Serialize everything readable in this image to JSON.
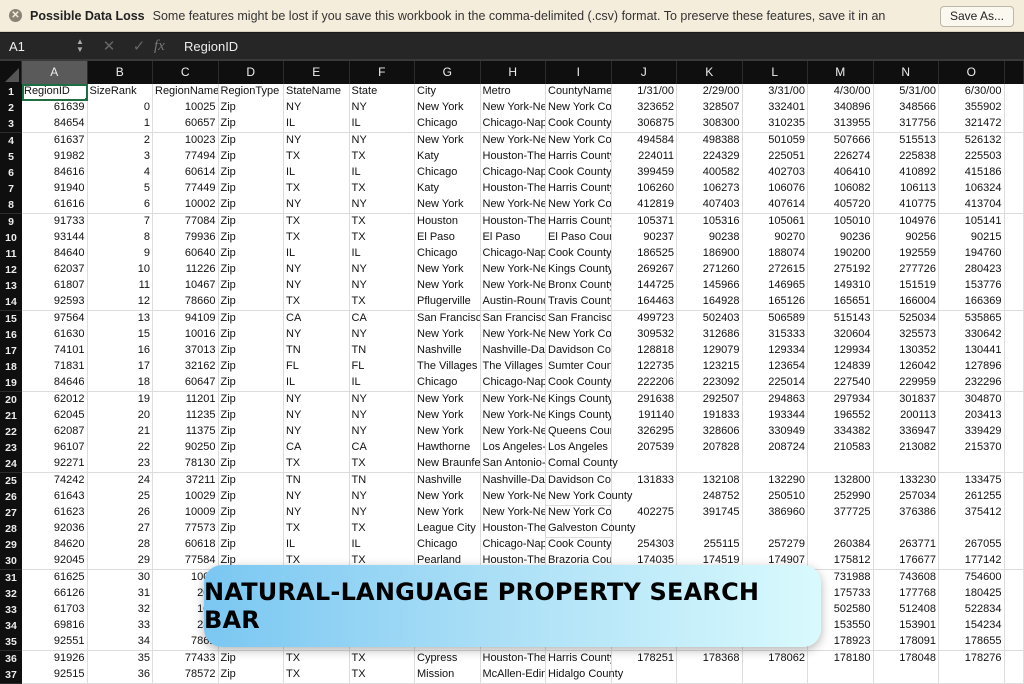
{
  "notice": {
    "icon": "close-circle-icon",
    "title": "Possible Data Loss",
    "message": "Some features might be lost if you save this workbook in the comma-delimited (.csv) format. To preserve these features, save it in an",
    "save_as": "Save As..."
  },
  "formula_bar": {
    "cell_ref": "A1",
    "cancel": "✕",
    "confirm": "✓",
    "fx": "fx",
    "value": "RegionID"
  },
  "columns": [
    "A",
    "B",
    "C",
    "D",
    "E",
    "F",
    "G",
    "H",
    "I",
    "J",
    "K",
    "L",
    "M",
    "N",
    "O"
  ],
  "selected_cell": "A1",
  "rows": [
    {
      "n": "1",
      "cells": [
        "RegionID",
        "SizeRank",
        "RegionName",
        "RegionType",
        "StateName",
        "State",
        "City",
        "Metro",
        "CountyName",
        "1/31/00",
        "2/29/00",
        "3/31/00",
        "4/30/00",
        "5/31/00",
        "6/30/00"
      ]
    },
    {
      "n": "2",
      "cells": [
        "61639",
        "0",
        "10025",
        "Zip",
        "NY",
        "NY",
        "New York",
        "New York-Ne",
        "New York Co",
        "323652",
        "328507",
        "332401",
        "340896",
        "348566",
        "355902"
      ]
    },
    {
      "n": "3",
      "cells": [
        "84654",
        "1",
        "60657",
        "Zip",
        "IL",
        "IL",
        "Chicago",
        "Chicago-Nap",
        "Cook County",
        "306875",
        "308300",
        "310235",
        "313955",
        "317756",
        "321472"
      ]
    },
    {
      "n": "4",
      "cells": [
        "61637",
        "2",
        "10023",
        "Zip",
        "NY",
        "NY",
        "New York",
        "New York-Ne",
        "New York Co",
        "494584",
        "498388",
        "501059",
        "507666",
        "515513",
        "526132"
      ]
    },
    {
      "n": "5",
      "cells": [
        "91982",
        "3",
        "77494",
        "Zip",
        "TX",
        "TX",
        "Katy",
        "Houston-The",
        "Harris County",
        "224011",
        "224329",
        "225051",
        "226274",
        "225838",
        "225503"
      ]
    },
    {
      "n": "6",
      "cells": [
        "84616",
        "4",
        "60614",
        "Zip",
        "IL",
        "IL",
        "Chicago",
        "Chicago-Nap",
        "Cook County",
        "399459",
        "400582",
        "402703",
        "406410",
        "410892",
        "415186"
      ]
    },
    {
      "n": "7",
      "cells": [
        "91940",
        "5",
        "77449",
        "Zip",
        "TX",
        "TX",
        "Katy",
        "Houston-The",
        "Harris County",
        "106260",
        "106273",
        "106076",
        "106082",
        "106113",
        "106324"
      ]
    },
    {
      "n": "8",
      "cells": [
        "61616",
        "6",
        "10002",
        "Zip",
        "NY",
        "NY",
        "New York",
        "New York-Ne",
        "New York Co",
        "412819",
        "407403",
        "407614",
        "405720",
        "410775",
        "413704"
      ]
    },
    {
      "n": "9",
      "cells": [
        "91733",
        "7",
        "77084",
        "Zip",
        "TX",
        "TX",
        "Houston",
        "Houston-The",
        "Harris County",
        "105371",
        "105316",
        "105061",
        "105010",
        "104976",
        "105141"
      ]
    },
    {
      "n": "10",
      "cells": [
        "93144",
        "8",
        "79936",
        "Zip",
        "TX",
        "TX",
        "El Paso",
        "El Paso",
        "El Paso Coun",
        "90237",
        "90238",
        "90270",
        "90236",
        "90256",
        "90215"
      ]
    },
    {
      "n": "11",
      "cells": [
        "84640",
        "9",
        "60640",
        "Zip",
        "IL",
        "IL",
        "Chicago",
        "Chicago-Nap",
        "Cook County",
        "186525",
        "186900",
        "188074",
        "190200",
        "192559",
        "194760"
      ]
    },
    {
      "n": "12",
      "cells": [
        "62037",
        "10",
        "11226",
        "Zip",
        "NY",
        "NY",
        "New York",
        "New York-Ne",
        "Kings County",
        "269267",
        "271260",
        "272615",
        "275192",
        "277726",
        "280423"
      ]
    },
    {
      "n": "13",
      "cells": [
        "61807",
        "11",
        "10467",
        "Zip",
        "NY",
        "NY",
        "New York",
        "New York-Ne",
        "Bronx County",
        "144725",
        "145966",
        "146965",
        "149310",
        "151519",
        "153776"
      ]
    },
    {
      "n": "14",
      "cells": [
        "92593",
        "12",
        "78660",
        "Zip",
        "TX",
        "TX",
        "Pflugerville",
        "Austin-Round",
        "Travis County",
        "164463",
        "164928",
        "165126",
        "165651",
        "166004",
        "166369"
      ]
    },
    {
      "n": "15",
      "cells": [
        "97564",
        "13",
        "94109",
        "Zip",
        "CA",
        "CA",
        "San Francisco",
        "San Francisco",
        "San Francisco",
        "499723",
        "502403",
        "506589",
        "515143",
        "525034",
        "535865"
      ]
    },
    {
      "n": "16",
      "cells": [
        "61630",
        "15",
        "10016",
        "Zip",
        "NY",
        "NY",
        "New York",
        "New York-Ne",
        "New York Co",
        "309532",
        "312686",
        "315333",
        "320604",
        "325573",
        "330642"
      ]
    },
    {
      "n": "17",
      "cells": [
        "74101",
        "16",
        "37013",
        "Zip",
        "TN",
        "TN",
        "Nashville",
        "Nashville-Da",
        "Davidson Cou",
        "128818",
        "129079",
        "129334",
        "129934",
        "130352",
        "130441"
      ]
    },
    {
      "n": "18",
      "cells": [
        "71831",
        "17",
        "32162",
        "Zip",
        "FL",
        "FL",
        "The Villages",
        "The Villages",
        "Sumter Coun",
        "122735",
        "123215",
        "123654",
        "124839",
        "126042",
        "127896"
      ]
    },
    {
      "n": "19",
      "cells": [
        "84646",
        "18",
        "60647",
        "Zip",
        "IL",
        "IL",
        "Chicago",
        "Chicago-Nap",
        "Cook County",
        "222206",
        "223092",
        "225014",
        "227540",
        "229959",
        "232296"
      ]
    },
    {
      "n": "20",
      "cells": [
        "62012",
        "19",
        "11201",
        "Zip",
        "NY",
        "NY",
        "New York",
        "New York-Ne",
        "Kings County",
        "291638",
        "292507",
        "294863",
        "297934",
        "301837",
        "304870"
      ]
    },
    {
      "n": "21",
      "cells": [
        "62045",
        "20",
        "11235",
        "Zip",
        "NY",
        "NY",
        "New York",
        "New York-Ne",
        "Kings County",
        "191140",
        "191833",
        "193344",
        "196552",
        "200113",
        "203413"
      ]
    },
    {
      "n": "22",
      "cells": [
        "62087",
        "21",
        "11375",
        "Zip",
        "NY",
        "NY",
        "New York",
        "New York-Ne",
        "Queens Coun",
        "326295",
        "328606",
        "330949",
        "334382",
        "336947",
        "339429"
      ]
    },
    {
      "n": "23",
      "cells": [
        "96107",
        "22",
        "90250",
        "Zip",
        "CA",
        "CA",
        "Hawthorne",
        "Los Angeles-",
        "Los Angeles",
        "207539",
        "207828",
        "208724",
        "210583",
        "213082",
        "215370"
      ]
    },
    {
      "n": "24",
      "cells": [
        "92271",
        "23",
        "78130",
        "Zip",
        "TX",
        "TX",
        "New Braunfels",
        "San Antonio-",
        "Comal County",
        "",
        "",
        "",
        "",
        "",
        ""
      ]
    },
    {
      "n": "25",
      "cells": [
        "74242",
        "24",
        "37211",
        "Zip",
        "TN",
        "TN",
        "Nashville",
        "Nashville-Da",
        "Davidson Cou",
        "131833",
        "132108",
        "132290",
        "132800",
        "133230",
        "133475"
      ]
    },
    {
      "n": "26",
      "cells": [
        "61643",
        "25",
        "10029",
        "Zip",
        "NY",
        "NY",
        "New York",
        "New York-Ne",
        "New York County",
        "",
        "248752",
        "250510",
        "252990",
        "257034",
        "261255"
      ]
    },
    {
      "n": "27",
      "cells": [
        "61623",
        "26",
        "10009",
        "Zip",
        "NY",
        "NY",
        "New York",
        "New York-Ne",
        "New York Co",
        "402275",
        "391745",
        "386960",
        "377725",
        "376386",
        "375412"
      ]
    },
    {
      "n": "28",
      "cells": [
        "92036",
        "27",
        "77573",
        "Zip",
        "TX",
        "TX",
        "League City",
        "Houston-The",
        "Galveston County",
        "",
        "",
        "",
        "",
        "",
        ""
      ]
    },
    {
      "n": "29",
      "cells": [
        "84620",
        "28",
        "60618",
        "Zip",
        "IL",
        "IL",
        "Chicago",
        "Chicago-Nap",
        "Cook County",
        "254303",
        "255115",
        "257279",
        "260384",
        "263771",
        "267055"
      ]
    },
    {
      "n": "30",
      "cells": [
        "92045",
        "29",
        "77584",
        "Zip",
        "TX",
        "TX",
        "Pearland",
        "Houston-The",
        "Brazoria Cou",
        "174035",
        "174519",
        "174907",
        "175812",
        "176677",
        "177142"
      ]
    },
    {
      "n": "31",
      "cells": [
        "61625",
        "30",
        "1001",
        "",
        "",
        "",
        "",
        "",
        "",
        "",
        "",
        "",
        "731988",
        "743608",
        "754600"
      ]
    },
    {
      "n": "32",
      "cells": [
        "66126",
        "31",
        "200",
        "",
        "",
        "",
        "",
        "",
        "",
        "",
        "",
        "",
        "175733",
        "177768",
        "180425"
      ]
    },
    {
      "n": "33",
      "cells": [
        "61703",
        "32",
        "101",
        "",
        "",
        "",
        "",
        "",
        "",
        "",
        "",
        "",
        "502580",
        "512408",
        "522834"
      ]
    },
    {
      "n": "34",
      "cells": [
        "69816",
        "33",
        "282",
        "",
        "",
        "",
        "",
        "",
        "",
        "",
        "",
        "",
        "153550",
        "153901",
        "154234"
      ]
    },
    {
      "n": "35",
      "cells": [
        "92551",
        "34",
        "7861",
        "",
        "",
        "",
        "",
        "",
        "",
        "",
        "",
        "",
        "178923",
        "178091",
        "178655"
      ]
    },
    {
      "n": "36",
      "cells": [
        "91926",
        "35",
        "77433",
        "Zip",
        "TX",
        "TX",
        "Cypress",
        "Houston-The",
        "Harris County",
        "178251",
        "178368",
        "178062",
        "178180",
        "178048",
        "178276"
      ]
    },
    {
      "n": "37",
      "cells": [
        "92515",
        "36",
        "78572",
        "Zip",
        "TX",
        "TX",
        "Mission",
        "McAllen-Edin",
        "Hidalgo County",
        "",
        "",
        "",
        "",
        "",
        ""
      ]
    }
  ],
  "banner": {
    "text": "NATURAL-LANGUAGE PROPERTY SEARCH BAR",
    "gradient_start": "#7ac7f2",
    "gradient_end": "#d9fafd"
  }
}
